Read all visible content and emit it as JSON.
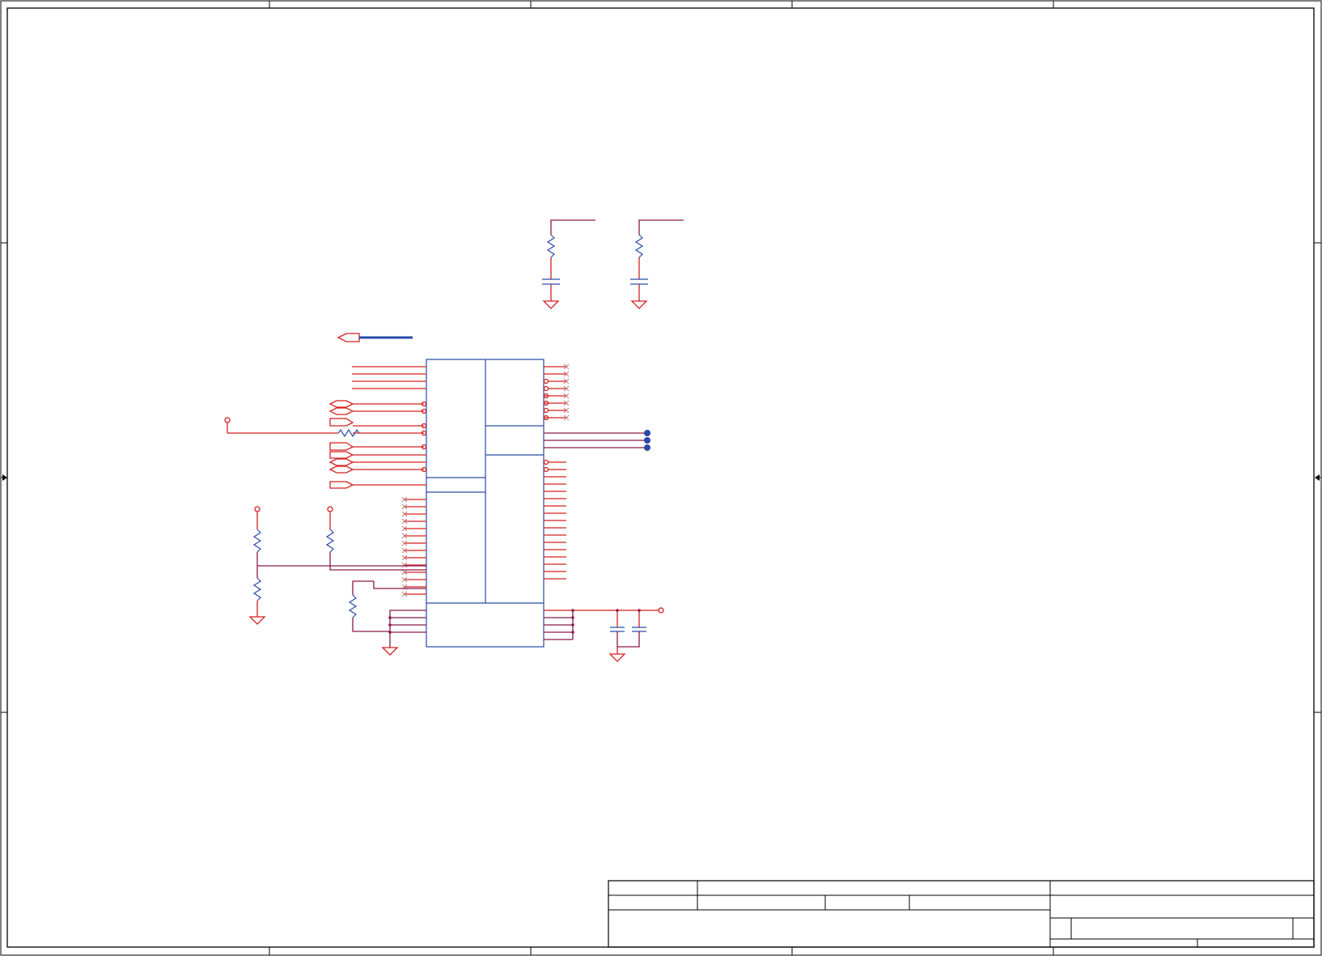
{
  "sheet": {
    "colors": {
      "frame": "#000000",
      "wire": "#d42020",
      "net": "#8a1a4a",
      "component": "#2a4aa8",
      "junction": "#2a4aa8"
    },
    "frame": {
      "zone_ticks_top": 4,
      "zone_ticks_bottom": 4,
      "zone_ticks_side": 2
    },
    "title_block": {
      "rows": [],
      "text": []
    },
    "components": [
      "pullup-resistor-left",
      "filter-capacitor-left",
      "pullup-resistor-right",
      "filter-capacitor-right",
      "main-ic",
      "bias-resistor-top",
      "bias-resistor-bottom",
      "bias-resistor-right",
      "strap-resistor",
      "series-resistor",
      "decoupling-capacitor-1",
      "decoupling-capacitor-2",
      "ground-symbol"
    ],
    "icon_names": [
      "ground-icon",
      "resistor-icon",
      "capacitor-icon",
      "off-page-connector-icon",
      "junction-dot-icon",
      "no-connect-icon",
      "power-pin-icon"
    ]
  }
}
